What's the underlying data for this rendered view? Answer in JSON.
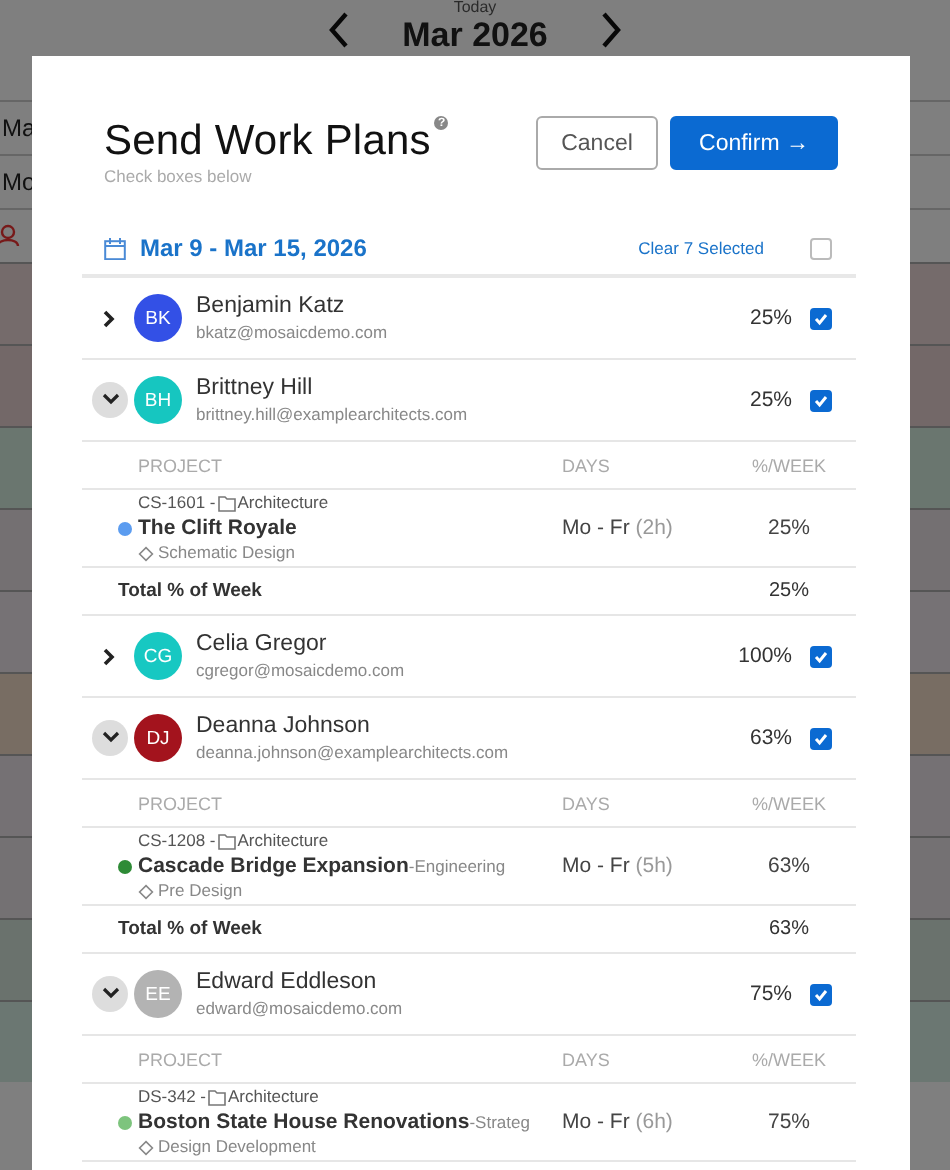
{
  "background": {
    "today": "Today",
    "month": "Mar 2026",
    "row_labels": [
      "Ma",
      "Mo"
    ]
  },
  "modal": {
    "title": "Send Work Plans",
    "help": "?",
    "subtitle": "Check boxes below",
    "cancel": "Cancel",
    "confirm": "Confirm",
    "confirm_arrow": "→",
    "date_range": "Mar 9 - Mar 15, 2026",
    "clear": "Clear 7 Selected",
    "select_all": false,
    "people": [
      {
        "initials": "BK",
        "color": "#3350e6",
        "name": "Benjamin Katz",
        "email": "bkatz@mosaicdemo.com",
        "percent": "25%",
        "checked": true,
        "expanded": false
      },
      {
        "initials": "BH",
        "color": "#16c6c0",
        "name": "Brittney Hill",
        "email": "brittney.hill@examplearchitects.com",
        "percent": "25%",
        "checked": true,
        "expanded": true,
        "columns": [
          "PROJECT",
          "DAYS",
          "%/WEEK"
        ],
        "projects": [
          {
            "code": "CS-1601 -",
            "category": "Architecture",
            "name": "The Clift Royale",
            "phase": "Schematic Design",
            "days": "Mo - Fr",
            "hours": "(2h)",
            "percent": "25%",
            "color": "#5b9cf0"
          }
        ],
        "total": {
          "label": "Total % of Week",
          "value": "25%"
        }
      },
      {
        "initials": "CG",
        "color": "#17c8c2",
        "name": "Celia Gregor",
        "email": "cgregor@mosaicdemo.com",
        "percent": "100%",
        "checked": true,
        "expanded": false
      },
      {
        "initials": "DJ",
        "color": "#a3131d",
        "name": "Deanna Johnson",
        "email": "deanna.johnson@examplearchitects.com",
        "percent": "63%",
        "checked": true,
        "expanded": true,
        "columns": [
          "PROJECT",
          "DAYS",
          "%/WEEK"
        ],
        "projects": [
          {
            "code": "CS-1208 -",
            "category": "Architecture",
            "name": "Cascade Bridge Expansion",
            "department": "-Engineering",
            "phase": "Pre Design",
            "days": "Mo - Fr",
            "hours": "(5h)",
            "percent": "63%",
            "color": "#2e8b36"
          }
        ],
        "total": {
          "label": "Total % of Week",
          "value": "63%"
        }
      },
      {
        "initials": "EE",
        "color": "#b3b3b3",
        "name": "Edward Eddleson",
        "email": "edward@mosaicdemo.com",
        "percent": "75%",
        "checked": true,
        "expanded": true,
        "columns": [
          "PROJECT",
          "DAYS",
          "%/WEEK"
        ],
        "projects": [
          {
            "code": "DS-342 -",
            "category": "Architecture",
            "name": "Boston State House Renovations",
            "department": "-Strateg",
            "phase": "Design Development",
            "days": "Mo - Fr",
            "hours": "(6h)",
            "percent": "75%",
            "color": "#7dc47d"
          }
        ]
      }
    ]
  }
}
